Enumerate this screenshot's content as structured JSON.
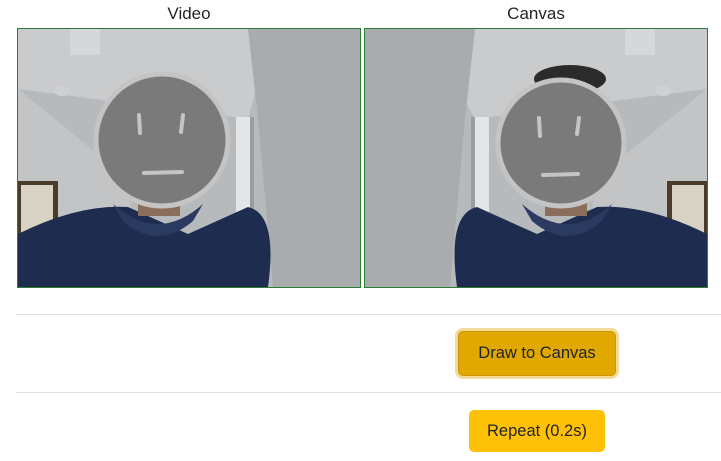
{
  "headers": {
    "video": "Video",
    "canvas": "Canvas"
  },
  "buttons": {
    "draw_to_canvas": "Draw to Canvas",
    "repeat": "Repeat (0.2s)"
  },
  "colors": {
    "pane_border": "#2e7d32",
    "draw_button": "#e0a800",
    "repeat_button": "#ffc107",
    "face_overlay": "#7a7a7a",
    "face_outline": "#c4c4c4"
  }
}
